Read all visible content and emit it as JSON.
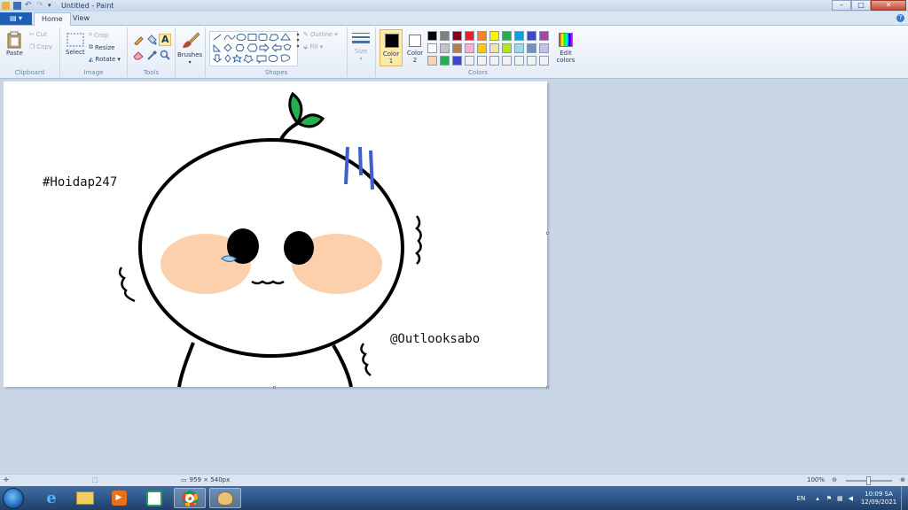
{
  "window": {
    "title": "Untitled - Paint"
  },
  "tabs": {
    "home": "Home",
    "view": "View"
  },
  "ribbon": {
    "clipboard": {
      "label": "Clipboard",
      "paste": "Paste",
      "cut": "Cut",
      "copy": "Copy"
    },
    "image": {
      "label": "Image",
      "select": "Select",
      "crop": "Crop",
      "resize": "Resize",
      "rotate": "Rotate"
    },
    "tools": {
      "label": "Tools"
    },
    "brushes": {
      "label": "Brushes"
    },
    "shapes": {
      "label": "Shapes",
      "outline": "Outline",
      "fill": "Fill"
    },
    "size": {
      "label": "Size"
    },
    "colors": {
      "label": "Colors",
      "color1": "Color 1",
      "color2": "Color 2",
      "edit": "Edit colors",
      "color1_value": "#000000",
      "color2_value": "#ffffff",
      "palette_row1": [
        "#000000",
        "#7f7f7f",
        "#880015",
        "#ed1c24",
        "#ff7f27",
        "#fff200",
        "#22b14c",
        "#00a2e8",
        "#3f48cc",
        "#a349a4"
      ],
      "palette_row2": [
        "#ffffff",
        "#c3c3c3",
        "#b97a57",
        "#ffaec9",
        "#ffc90e",
        "#efe4b0",
        "#b5e61d",
        "#99d9ea",
        "#7092be",
        "#c8bfe7"
      ],
      "palette_row3": [
        "#fcd0b4",
        "#22b14c",
        "#3f48cc",
        "#f2f2f2",
        "#f2f2f2",
        "#f2f2f2",
        "#f2f2f2",
        "#f2f2f2",
        "#f2f2f2",
        "#f2f2f2"
      ]
    }
  },
  "canvas": {
    "text_left": "#Hoidap247",
    "text_right": "@Outlooksabo",
    "colors": {
      "cheek": "#fdd0ad",
      "leaf": "#22b14c",
      "sweat": "#3f5fcc",
      "tear": "#9fd0f0"
    }
  },
  "status": {
    "size": "959 × 540px",
    "zoom": "100%",
    "zoom_fraction": 0.5
  },
  "taskbar": {
    "lang": "EN",
    "time": "10:09 SA",
    "date": "12/09/2021"
  }
}
